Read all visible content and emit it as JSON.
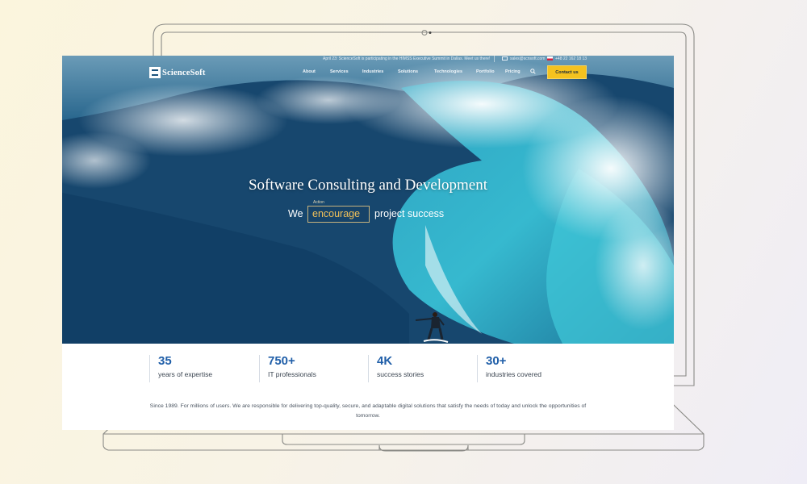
{
  "topbar": {
    "news": "April 23: ScienceSoft is participating in the HIMSS Executive Summit in Dallas. Meet us there!",
    "email": "sales@scnsoft.com",
    "phone": "+48 22 162 18 13"
  },
  "logo": {
    "text": "ScienceSoft"
  },
  "nav": {
    "items": [
      "About",
      "Services",
      "Industries",
      "Solutions",
      "Technologies",
      "Portfolio",
      "Pricing"
    ],
    "contact_label": "Contact us"
  },
  "hero": {
    "title": "Software Consulting and Development",
    "tagline_prefix": "We",
    "rotator_label": "Action",
    "rotator_word": "encourage",
    "tagline_suffix": "project success"
  },
  "stats": [
    {
      "value": "35",
      "label": "years of expertise"
    },
    {
      "value": "750+",
      "label": "IT professionals"
    },
    {
      "value": "4K",
      "label": "success stories"
    },
    {
      "value": "30+",
      "label": "industries covered"
    }
  ],
  "about": "Since 1989. For millions of users. We are responsible for delivering top-quality, secure, and adaptable digital solutions that satisfy the needs of today and unlock the opportunities of tomorrow.",
  "colors": {
    "accent_button": "#f4c21f",
    "stat_number": "#1f5ea8",
    "rotator_word": "#f0c05a"
  },
  "icons": {
    "search": "search-icon",
    "mail": "mail-icon",
    "flag": "poland-flag-icon"
  }
}
